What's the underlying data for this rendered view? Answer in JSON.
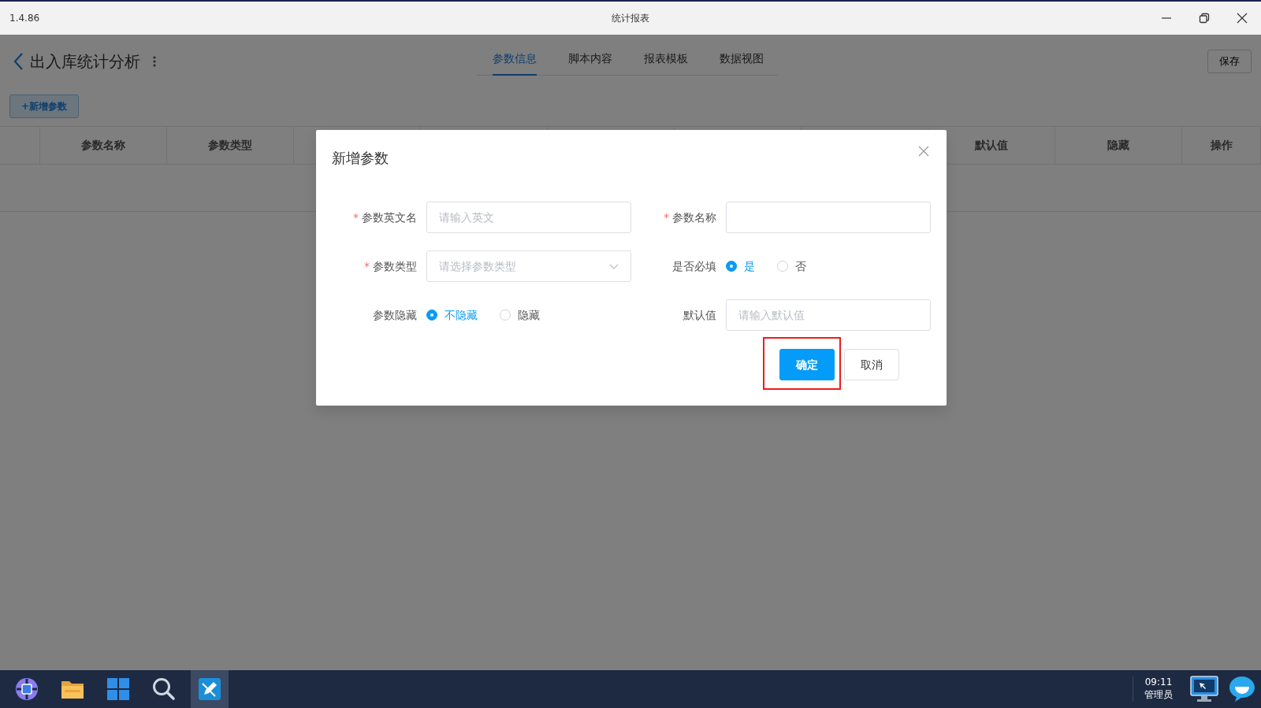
{
  "window": {
    "version": "1.4.86",
    "title": "统计报表"
  },
  "header": {
    "title": "出入库统计分析",
    "tabs": [
      {
        "label": "参数信息",
        "selected": true
      },
      {
        "label": "脚本内容",
        "selected": false
      },
      {
        "label": "报表模板",
        "selected": false
      },
      {
        "label": "数据视图",
        "selected": false
      }
    ],
    "save_button": "保存"
  },
  "add_button": "+新增参数",
  "table": {
    "columns": [
      "参数名称",
      "参数类型",
      "默认值",
      "隐藏",
      "操作"
    ]
  },
  "dialog": {
    "title": "新增参数",
    "fields": [
      {
        "kind": "input",
        "label": "参数英文名",
        "required_mark": "*",
        "placeholder": "请输入英文"
      },
      {
        "kind": "input",
        "label": "参数名称",
        "required_mark": "*"
      },
      {
        "kind": "select",
        "label": "参数类型",
        "required_mark": "*",
        "placeholder": "请选择参数类型"
      },
      {
        "kind": "radio",
        "label": "是否必填",
        "options": [
          {
            "label": "是",
            "selected": true
          },
          {
            "label": "否",
            "selected": false
          }
        ]
      },
      {
        "kind": "radio",
        "label": "参数隐藏",
        "options": [
          {
            "label": "不隐藏",
            "selected": true
          },
          {
            "label": "隐藏",
            "selected": false
          }
        ]
      },
      {
        "kind": "input",
        "label": "默认值",
        "placeholder": "请输入默认值"
      }
    ],
    "buttons": [
      {
        "label": "确定",
        "kind": "primary",
        "highlighted": true
      },
      {
        "label": "取消",
        "kind": "default",
        "highlighted": false
      }
    ]
  },
  "taskbar": {
    "apps": [
      {
        "kind": "logo",
        "active": false
      },
      {
        "kind": "folder",
        "active": false
      },
      {
        "kind": "start",
        "active": false
      },
      {
        "kind": "search",
        "active": false
      },
      {
        "kind": "editor",
        "active": true
      }
    ],
    "time": "09:11",
    "user": "管理员"
  }
}
